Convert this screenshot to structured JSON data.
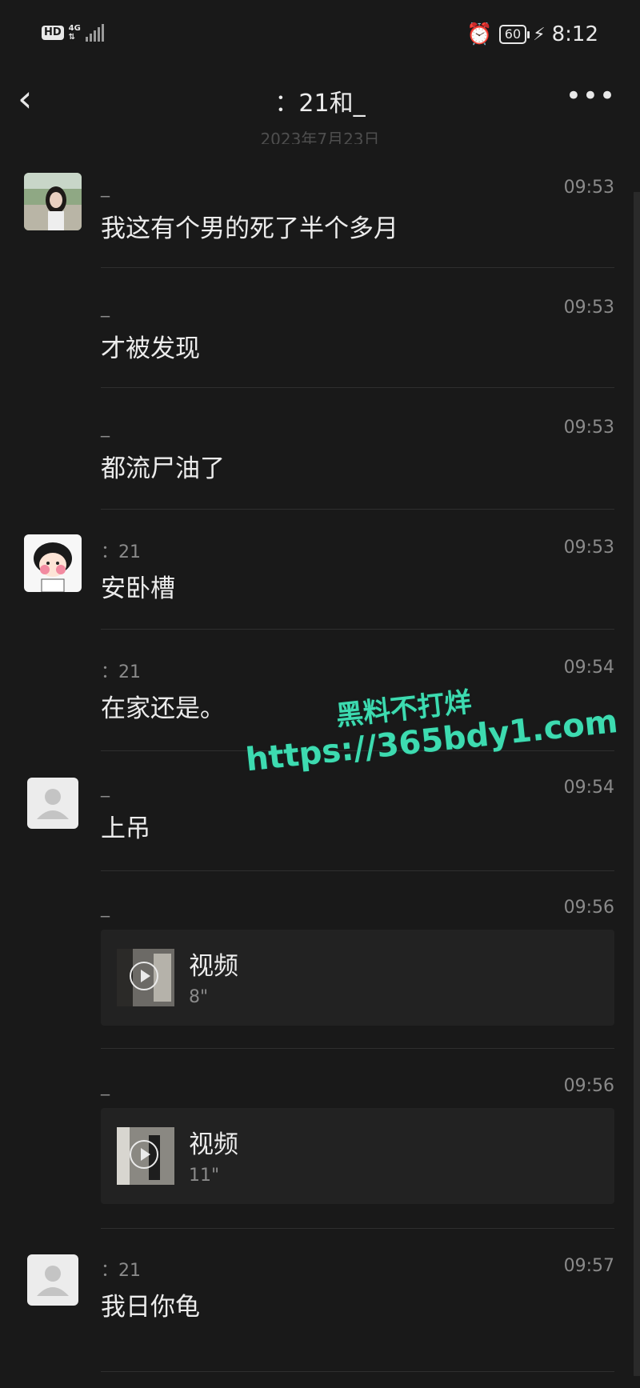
{
  "status_bar": {
    "hd": "HD",
    "network": "4G",
    "battery": "60",
    "time": "8:12",
    "icons": [
      "alarm-icon",
      "battery-icon",
      "charging-icon",
      "signal-icon"
    ]
  },
  "header": {
    "title": "：21和_",
    "back_icon": "back-chevron-icon",
    "more_icon": "more-icon"
  },
  "date_caption": "2023年7月23日",
  "messages": [
    {
      "sender": "_",
      "time": "09:53",
      "text": "我这有个男的死了半个多月",
      "avatar": "photo-girl"
    },
    {
      "sender": "_",
      "time": "09:53",
      "text": "才被发现"
    },
    {
      "sender": "_",
      "time": "09:53",
      "text": "都流尸油了"
    },
    {
      "sender": "：21",
      "time": "09:53",
      "text": "安卧槽",
      "avatar": "cartoon-girl"
    },
    {
      "sender": "：21",
      "time": "09:54",
      "text": "在家还是。"
    },
    {
      "sender": "_",
      "time": "09:54",
      "text": "上吊",
      "avatar": "default-person"
    },
    {
      "sender": "_",
      "time": "09:56",
      "video": {
        "title": "视频",
        "duration": "8\""
      }
    },
    {
      "sender": "_",
      "time": "09:56",
      "video": {
        "title": "视频",
        "duration": "11\""
      }
    },
    {
      "sender": "：21",
      "time": "09:57",
      "text": "我日你龟",
      "avatar": "default-person"
    }
  ],
  "watermark": {
    "line1": "黑料不打烊",
    "line2": "https://365bdy1.com"
  },
  "colors": {
    "background": "#191919",
    "text": "#ececec",
    "muted": "#8a8a8a",
    "watermark": "#3ddbb0"
  }
}
